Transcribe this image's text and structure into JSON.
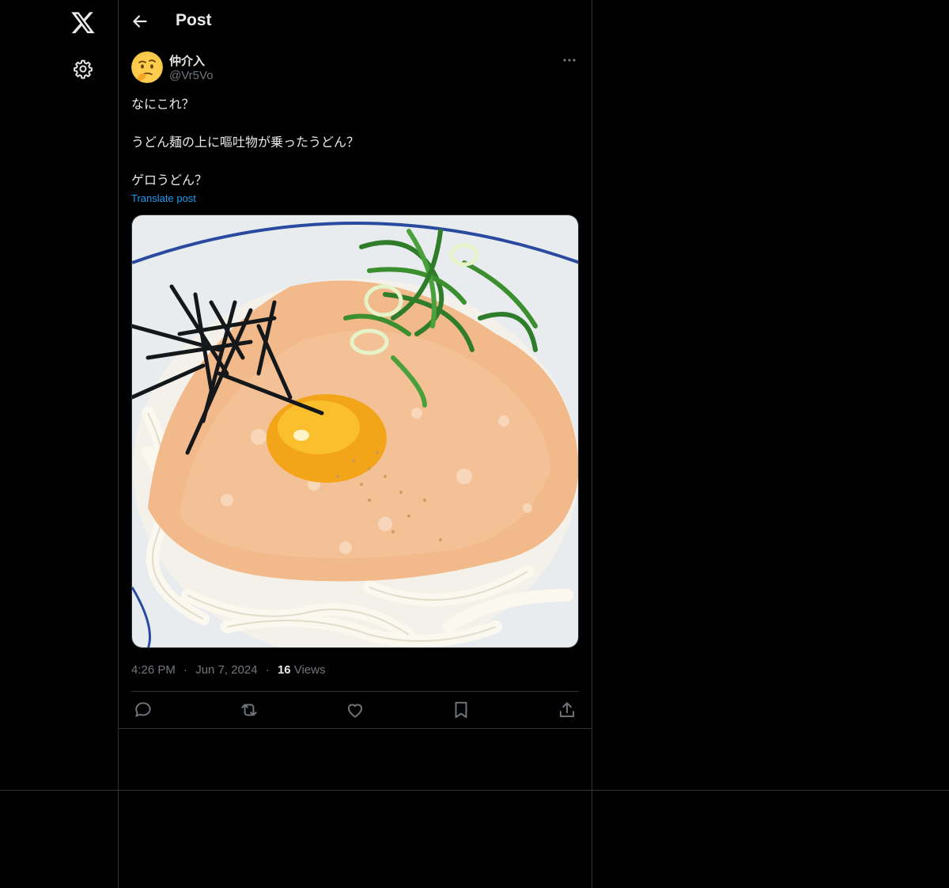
{
  "nav": {
    "logo_icon": "x-logo-icon",
    "settings_icon": "gear-icon"
  },
  "header": {
    "back_icon": "arrow-left-icon",
    "title": "Post"
  },
  "post": {
    "author": {
      "display_name": "仲介入",
      "handle": "@Vr5Vo",
      "avatar": "thinking-face-emoji"
    },
    "text": "なにこれ？\n\nうどん麺の上に嘔吐物が乗ったうどん？\n\nゲロうどん？",
    "translate_label": "Translate post",
    "media": {
      "description_icon": "udon-photo"
    },
    "time": "4:26 PM",
    "dot": "·",
    "date": "Jun 7, 2024",
    "views_count": "16",
    "views_label": "Views"
  },
  "actions": {
    "reply_icon": "reply-icon",
    "repost_icon": "repost-icon",
    "like_icon": "heart-icon",
    "bookmark_icon": "bookmark-icon",
    "share_icon": "share-icon"
  },
  "colors": {
    "background": "#000000",
    "text": "#e7e9ea",
    "muted": "#71767b",
    "link": "#1d9bf0",
    "border": "#2f3336"
  }
}
